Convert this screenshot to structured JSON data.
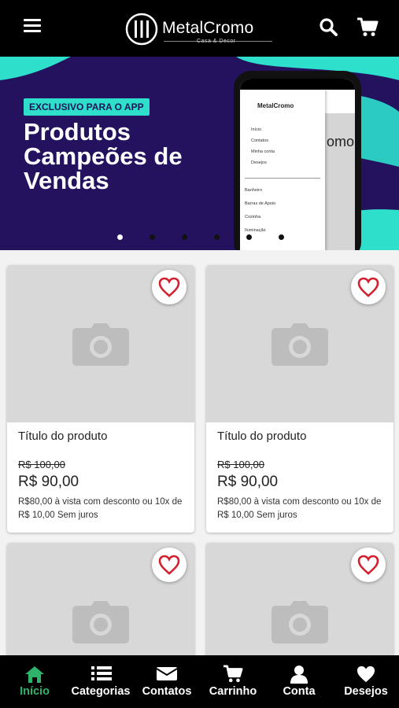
{
  "header": {
    "logo_name": "MetalCromo",
    "logo_tagline": "Casa & Decor",
    "menu_icon": "hamburger-menu-icon",
    "search_icon": "search-icon",
    "cart_icon": "shopping-cart-icon"
  },
  "banner": {
    "badge": "EXCLUSIVO PARA O APP",
    "title_line1": "Produtos",
    "title_line2": "Campeões de",
    "title_line3": "Vendas",
    "phone_mockup": {
      "logo": "MetalCromo",
      "menu_items": [
        "Início",
        "Contatos",
        "Minha conta",
        "Desejos"
      ],
      "categories": [
        "Banheiro",
        "Barras de Apoio",
        "Cozinha",
        "Iluminação"
      ],
      "side_text": "omo"
    },
    "colors": {
      "background": "#24125f",
      "accent": "#2ee0cc"
    },
    "carousel_slides": 6,
    "carousel_active": 1
  },
  "products": [
    {
      "title": "Título do produto",
      "old_price": "R$ 100,00",
      "price": "R$ 90,00",
      "installment": "R$80,00 à vista com desconto ou 10x de R$ 10,00 Sem juros"
    },
    {
      "title": "Título do produto",
      "old_price": "R$ 100,00",
      "price": "R$ 90,00",
      "installment": "R$80,00 à vista com desconto ou 10x de R$ 10,00 Sem juros"
    },
    {
      "title": "",
      "old_price": "",
      "price": "",
      "installment": ""
    },
    {
      "title": "",
      "old_price": "",
      "price": "",
      "installment": ""
    }
  ],
  "bottom_nav": [
    {
      "label": "Início",
      "icon": "home-icon",
      "active": true
    },
    {
      "label": "Categorias",
      "icon": "list-icon",
      "active": false
    },
    {
      "label": "Contatos",
      "icon": "envelope-icon",
      "active": false
    },
    {
      "label": "Carrinho",
      "icon": "shopping-cart-icon",
      "active": false
    },
    {
      "label": "Conta",
      "icon": "user-icon",
      "active": false
    },
    {
      "label": "Desejos",
      "icon": "heart-icon",
      "active": false
    }
  ],
  "colors": {
    "active_nav": "#2fb36a",
    "heart": "#d3202f"
  }
}
